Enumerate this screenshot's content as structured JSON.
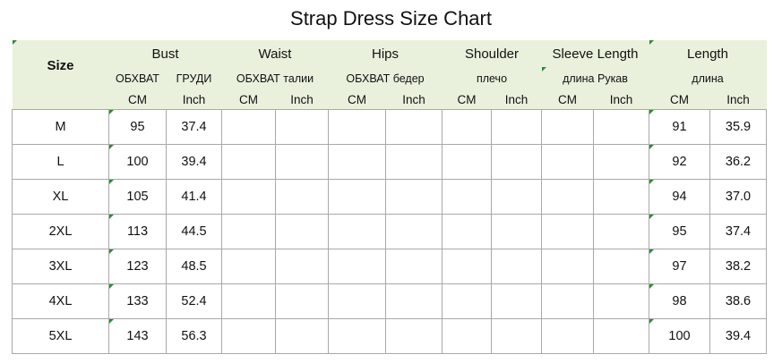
{
  "title": "Strap Dress Size Chart",
  "header": {
    "size": "Size",
    "groups": [
      {
        "name": "Bust",
        "sub": [
          "ОБХВАТ",
          "ГРУДИ"
        ]
      },
      {
        "name": "Waist",
        "sub": [
          "ОБХВАТ талии"
        ]
      },
      {
        "name": "Hips",
        "sub": [
          "ОБХВАТ бедер"
        ]
      },
      {
        "name": "Shoulder",
        "sub": [
          "плечо"
        ]
      },
      {
        "name": "Sleeve Length",
        "sub": [
          "длина Рукав"
        ]
      },
      {
        "name": "Length",
        "sub": [
          "длина"
        ]
      }
    ],
    "units": [
      "CM",
      "Inch"
    ]
  },
  "rows": [
    {
      "size": "M",
      "bust_cm": "95",
      "bust_inch": "37.4",
      "length_cm": "91",
      "length_inch": "35.9"
    },
    {
      "size": "L",
      "bust_cm": "100",
      "bust_inch": "39.4",
      "length_cm": "92",
      "length_inch": "36.2"
    },
    {
      "size": "XL",
      "bust_cm": "105",
      "bust_inch": "41.4",
      "length_cm": "94",
      "length_inch": "37.0"
    },
    {
      "size": "2XL",
      "bust_cm": "113",
      "bust_inch": "44.5",
      "length_cm": "95",
      "length_inch": "37.4"
    },
    {
      "size": "3XL",
      "bust_cm": "123",
      "bust_inch": "48.5",
      "length_cm": "97",
      "length_inch": "38.2"
    },
    {
      "size": "4XL",
      "bust_cm": "133",
      "bust_inch": "52.4",
      "length_cm": "98",
      "length_inch": "38.6"
    },
    {
      "size": "5XL",
      "bust_cm": "143",
      "bust_inch": "56.3",
      "length_cm": "100",
      "length_inch": "39.4"
    }
  ],
  "colors": {
    "header_bg": "#e9f1dd",
    "grid": "#a9a9a9",
    "corner_mark": "#2e8b32"
  }
}
